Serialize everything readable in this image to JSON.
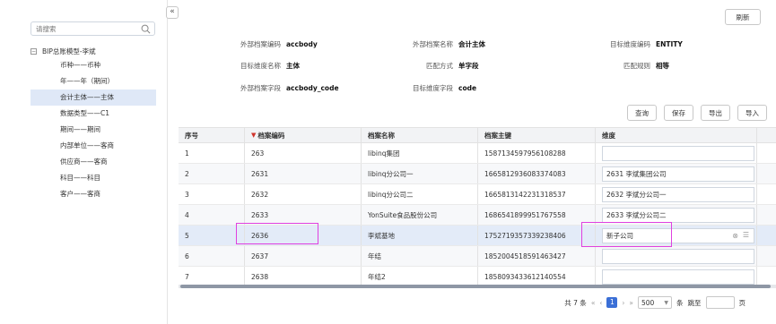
{
  "sidebar": {
    "search_placeholder": "请搜索",
    "root_label": "BIP总账模型-李斌",
    "toggle_symbol": "−",
    "items": [
      {
        "label": "币种——币种"
      },
      {
        "label": "年——年（期间）"
      },
      {
        "label": "会计主体——主体"
      },
      {
        "label": "数据类型——C1"
      },
      {
        "label": "期间——期间"
      },
      {
        "label": "内部单位——客商"
      },
      {
        "label": "供应商——客商"
      },
      {
        "label": "科目——科目"
      },
      {
        "label": "客户——客商"
      }
    ],
    "selected_index": 2,
    "collapse_symbol": "«"
  },
  "toolbar": {
    "refresh_label": "刷新"
  },
  "info": {
    "ext_code_key": "外部档案编码",
    "ext_code_val": "accbody",
    "ext_name_key": "外部档案名称",
    "ext_name_val": "会计主体",
    "target_code_key": "目标维度编码",
    "target_code_val": "ENTITY",
    "target_name_key": "目标维度名称",
    "target_name_val": "主体",
    "match_mode_key": "匹配方式",
    "match_mode_val": "单字段",
    "match_rule_key": "匹配规则",
    "match_rule_val": "相等",
    "ext_field_key": "外部档案字段",
    "ext_field_val": "accbody_code",
    "target_field_key": "目标维度字段",
    "target_field_val": "code"
  },
  "actions": {
    "query": "查询",
    "save": "保存",
    "export": "导出",
    "import": "导入"
  },
  "table": {
    "headers": {
      "seq": "序号",
      "code": "档案编码",
      "name": "档案名称",
      "key": "档案主键",
      "dim": "维度"
    },
    "rows": [
      {
        "seq": "1",
        "code": "263",
        "name": "libinq集团",
        "key": "1587134597956108288",
        "dim": ""
      },
      {
        "seq": "2",
        "code": "2631",
        "name": "libinq分公司一",
        "key": "1665812936083374083",
        "dim": "2631 李斌集团公司"
      },
      {
        "seq": "3",
        "code": "2632",
        "name": "libinq分公司二",
        "key": "1665813142231318537",
        "dim": "2632 李斌分公司一"
      },
      {
        "seq": "4",
        "code": "2633",
        "name": "YonSuite食品股份公司",
        "key": "1686541899951767558",
        "dim": "2633 李斌分公司二"
      },
      {
        "seq": "5",
        "code": "2636",
        "name": "李斌基地",
        "key": "1752719357339238406",
        "dim": "新子公司"
      },
      {
        "seq": "6",
        "code": "2637",
        "name": "年结",
        "key": "1852004518591463427",
        "dim": ""
      },
      {
        "seq": "7",
        "code": "2638",
        "name": "年结2",
        "key": "1858093433612140554",
        "dim": ""
      }
    ]
  },
  "pager": {
    "total_text": "共 7 条",
    "first": "«",
    "prev": "‹",
    "current_page": "1",
    "next": "›",
    "last": "»",
    "page_size": "500",
    "unit": "条",
    "jump_label": "跳至",
    "page_suffix": "页"
  },
  "colors": {
    "accent": "#3b6fd6",
    "highlight_row": "#e3ebf8",
    "marker": "#e040e0"
  }
}
